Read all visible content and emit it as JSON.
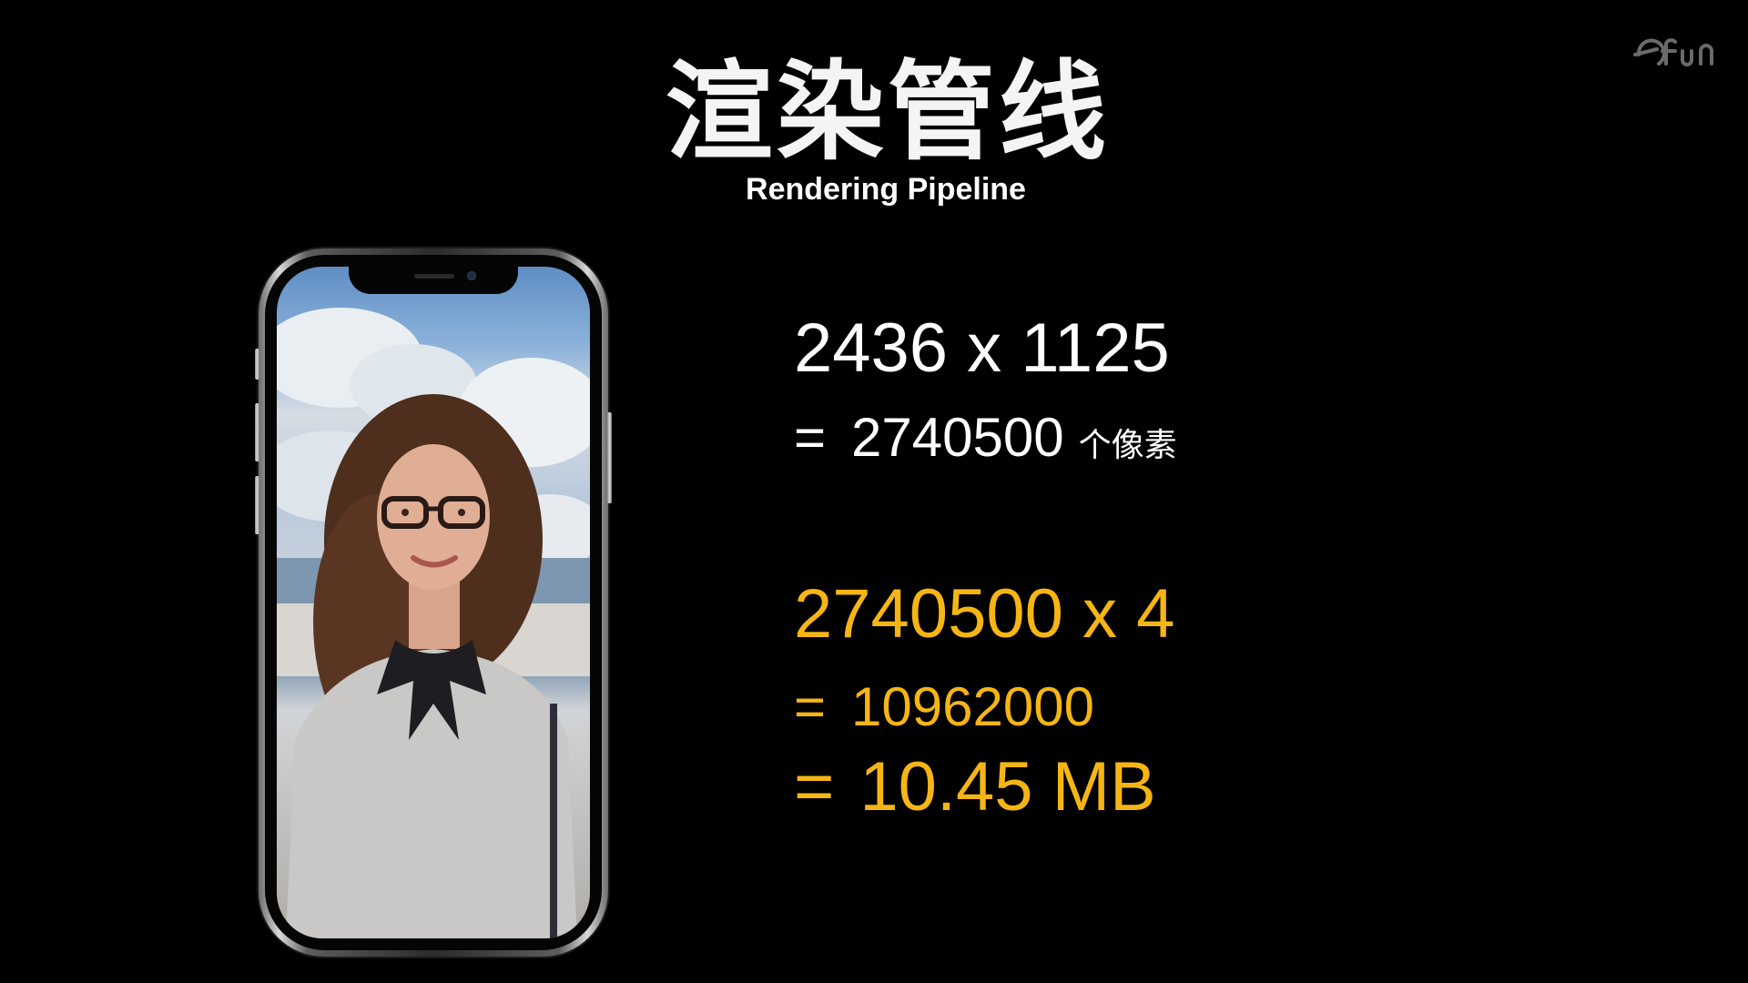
{
  "title": "渲染管线",
  "subtitle": "Rendering Pipeline",
  "logo": {
    "text": "efun",
    "icon": "efun-logo-icon"
  },
  "phone": {
    "image_description_icon": "phone-portrait-photo-icon"
  },
  "calc": {
    "resolution": "2436 x 1125",
    "pixels_eq": "=",
    "pixels_value": "2740500",
    "pixels_unit": "个像素",
    "bytes_expr": "2740500 x 4",
    "bytes_eq": "=",
    "bytes_value": "10962000",
    "mb_eq": "=",
    "mb_value": "10.45 MB"
  },
  "colors": {
    "background": "#000000",
    "text": "#ffffff",
    "accent": "#f5b514"
  }
}
